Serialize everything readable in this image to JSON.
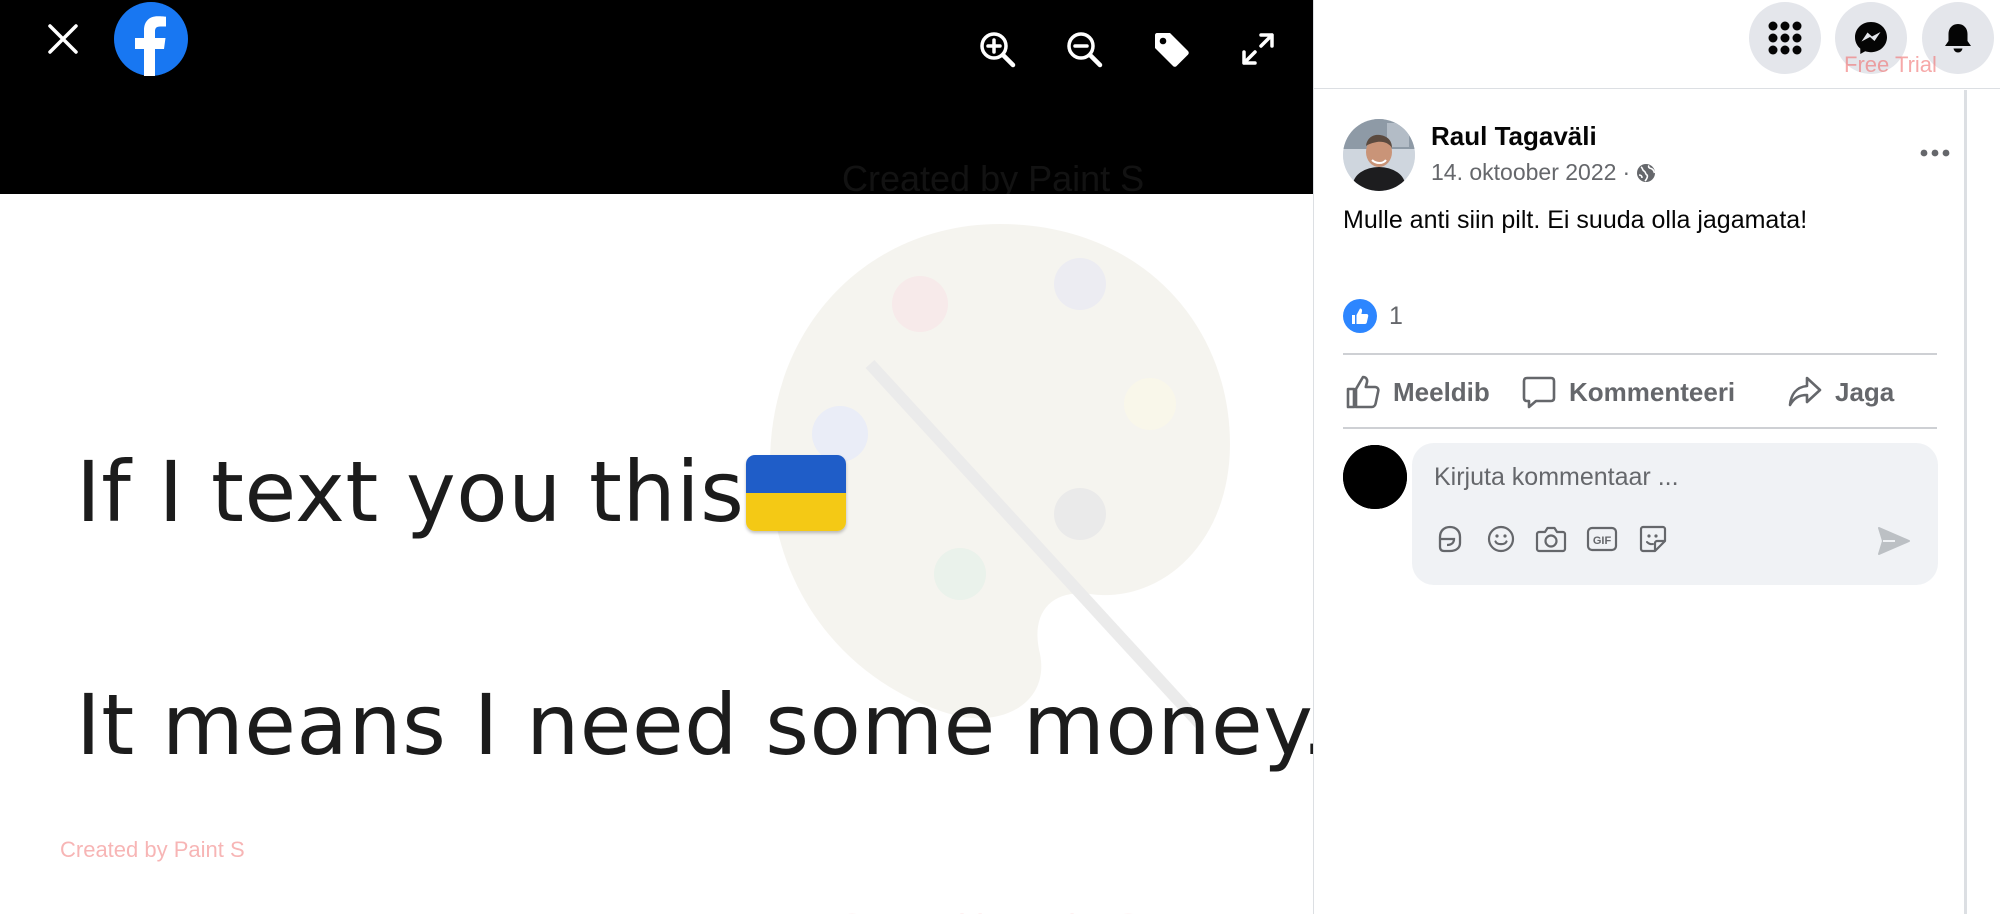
{
  "viewer": {
    "photo_lines": [
      "If I text you this:",
      "It means I need some money."
    ],
    "watermarks": {
      "top": "Created by Paint S",
      "middle": "Created by Paint S",
      "bottom": "Created by Paint S"
    },
    "flag_colors": {
      "blue": "#1f5dc8",
      "yellow": "#f4c915"
    }
  },
  "panel": {
    "free_trial": "Free Trial"
  },
  "post": {
    "author": "Raul Tagaväli",
    "date": "14. oktoober 2022",
    "separator": "·",
    "text": "Mulle anti siin pilt. Ei suuda olla jagamata!",
    "reaction_count": "1",
    "actions": {
      "like": "Meeldib",
      "comment": "Kommenteeri",
      "share": "Jaga"
    },
    "comment_placeholder": "Kirjuta kommentaar ..."
  },
  "colors": {
    "accent": "#1877f2",
    "like_badge": "#2d86ff",
    "secondary_text": "#65676b",
    "comment_box_bg": "#f0f2f5"
  },
  "icons": [
    "close-icon",
    "facebook-logo",
    "zoom-in-icon",
    "zoom-out-icon",
    "tag-icon",
    "fullscreen-icon",
    "menu-grid-icon",
    "messenger-icon",
    "bell-icon",
    "globe-icon",
    "more-dots-icon",
    "thumbs-up-icon",
    "comment-icon",
    "share-icon",
    "emoji-icon",
    "camera-icon",
    "gif-icon",
    "sticker-icon",
    "send-icon"
  ]
}
